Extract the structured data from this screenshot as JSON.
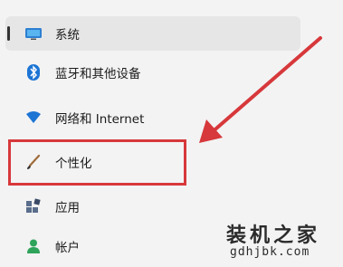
{
  "sidebar": {
    "items": [
      {
        "label": "系统",
        "icon": "monitor-icon"
      },
      {
        "label": "蓝牙和其他设备",
        "icon": "bluetooth-icon"
      },
      {
        "label": "网络和 Internet",
        "icon": "wifi-icon"
      },
      {
        "label": "个性化",
        "icon": "brush-icon"
      },
      {
        "label": "应用",
        "icon": "apps-icon"
      },
      {
        "label": "帐户",
        "icon": "account-icon"
      }
    ],
    "selected_index": 0
  },
  "annotation": {
    "highlight_color": "#d7383b",
    "highlighted_item": "个性化"
  },
  "watermark": {
    "title": "装机之家",
    "url": "gdhjbk.com"
  },
  "colors": {
    "accent": "#0067c0",
    "background": "#f3f3f3"
  }
}
